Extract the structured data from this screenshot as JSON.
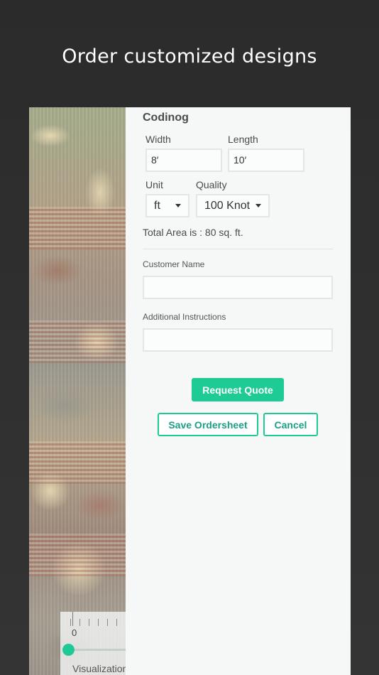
{
  "headline": "Order customized designs",
  "design": {
    "name": "Codinog"
  },
  "dimensions": {
    "width_label": "Width",
    "width_value": "8′",
    "length_label": "Length",
    "length_value": "10′"
  },
  "unit": {
    "label": "Unit",
    "selected": "ft"
  },
  "quality": {
    "label": "Quality",
    "selected": "100 Knot"
  },
  "total_area": "Total Area is : 80 sq. ft.",
  "customer_name": {
    "label": "Customer Name",
    "value": ""
  },
  "instructions": {
    "label": "Additional Instructions",
    "value": ""
  },
  "buttons": {
    "request_quote": "Request Quote",
    "save_ordersheet": "Save Ordersheet",
    "cancel": "Cancel"
  },
  "visualization": {
    "ruler_zero": "0",
    "label": "Visualization",
    "slider_value": 0
  },
  "colors": {
    "accent": "#1fcb94",
    "background": "#2f2f2f",
    "panel": "#f6f8f8"
  }
}
